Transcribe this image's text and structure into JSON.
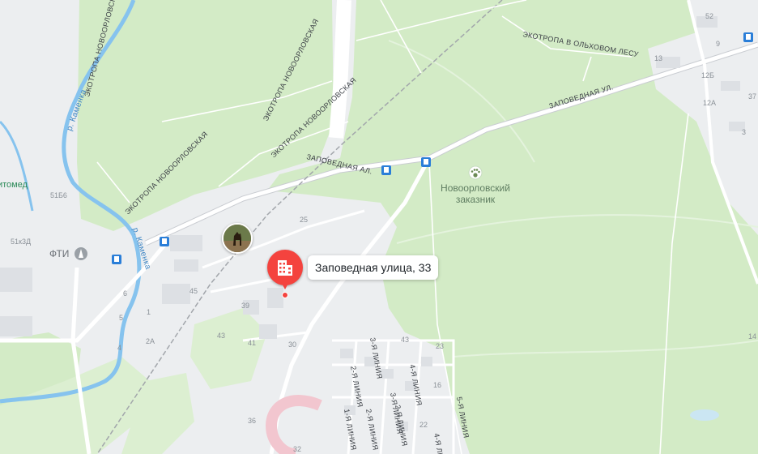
{
  "map": {
    "selected_address": "Заповедная улица, 33",
    "reserve_label": {
      "line1": "Новоорловский",
      "line2": "заказник"
    },
    "poi": {
      "fti": "ФТИ",
      "vet_fragment": "итомед"
    },
    "colors": {
      "forest": "#d3ebc6",
      "urban": "#eceef0",
      "road": "#ffffff",
      "water": "#86c3ee",
      "rail": "#a2a6ab",
      "pin": "#f4433e",
      "transit": "#2a7ed8"
    },
    "streets": {
      "zapovednaya_ul": "ЗАПОВЕДНАЯ УЛ.",
      "zapovednaya_al": "ЗАПОВЕДНАЯ АЛ.",
      "ecotrail_olkhovy": "ЭКОТРОПА В ОЛЬХОВОМ ЛЕСУ",
      "ecotrail_novoorl_1": "ЭКОТРОПА НОВООРЛОВСКАЯ",
      "ecotrail_novoorl_2": "ЭКОТРОПА НОВООРЛОВСКАЯ",
      "ecotrail_novoorl_3": "ЭКОТРОПА НОВООРЛОВСКАЯ",
      "ecotrail_novoorl_4": "ЭКОТРОПА НОВООРЛОВСК",
      "line3": "3-Я ЛИНИЯ",
      "line2": "2-Я ЛИНИЯ",
      "line4": "4-Я ЛИНИЯ",
      "line3b": "3-Я ЛИНИЯ",
      "line5": "5-Я ЛИНИЯ",
      "line1": "1-Я ЛИНИЯ",
      "line2b": "2-Я ЛИНИЯ",
      "line2c": "2-Я ЛИНИЯ",
      "line4b": "4-Я ЛИ"
    },
    "rivers": {
      "kamenka_1": "р. Каменка",
      "kamenka_2": "р. Каменка"
    },
    "house_numbers": {
      "n52": "52",
      "n9": "9",
      "n13": "13",
      "n12b": "12Б",
      "n12a": "12А",
      "n37": "37",
      "n3": "3",
      "n25": "25",
      "n45": "45",
      "n39": "39",
      "n43": "43",
      "n41": "41",
      "n30": "30",
      "n43b": "43",
      "n36": "36",
      "n32": "32",
      "n16": "16",
      "n22": "22",
      "n23": "23",
      "n51b6": "51Б6",
      "n51k3d": "51к3Д",
      "n6": "6",
      "n1": "1",
      "n2a": "2А",
      "n4": "4",
      "n5": "5",
      "n14": "14"
    }
  }
}
